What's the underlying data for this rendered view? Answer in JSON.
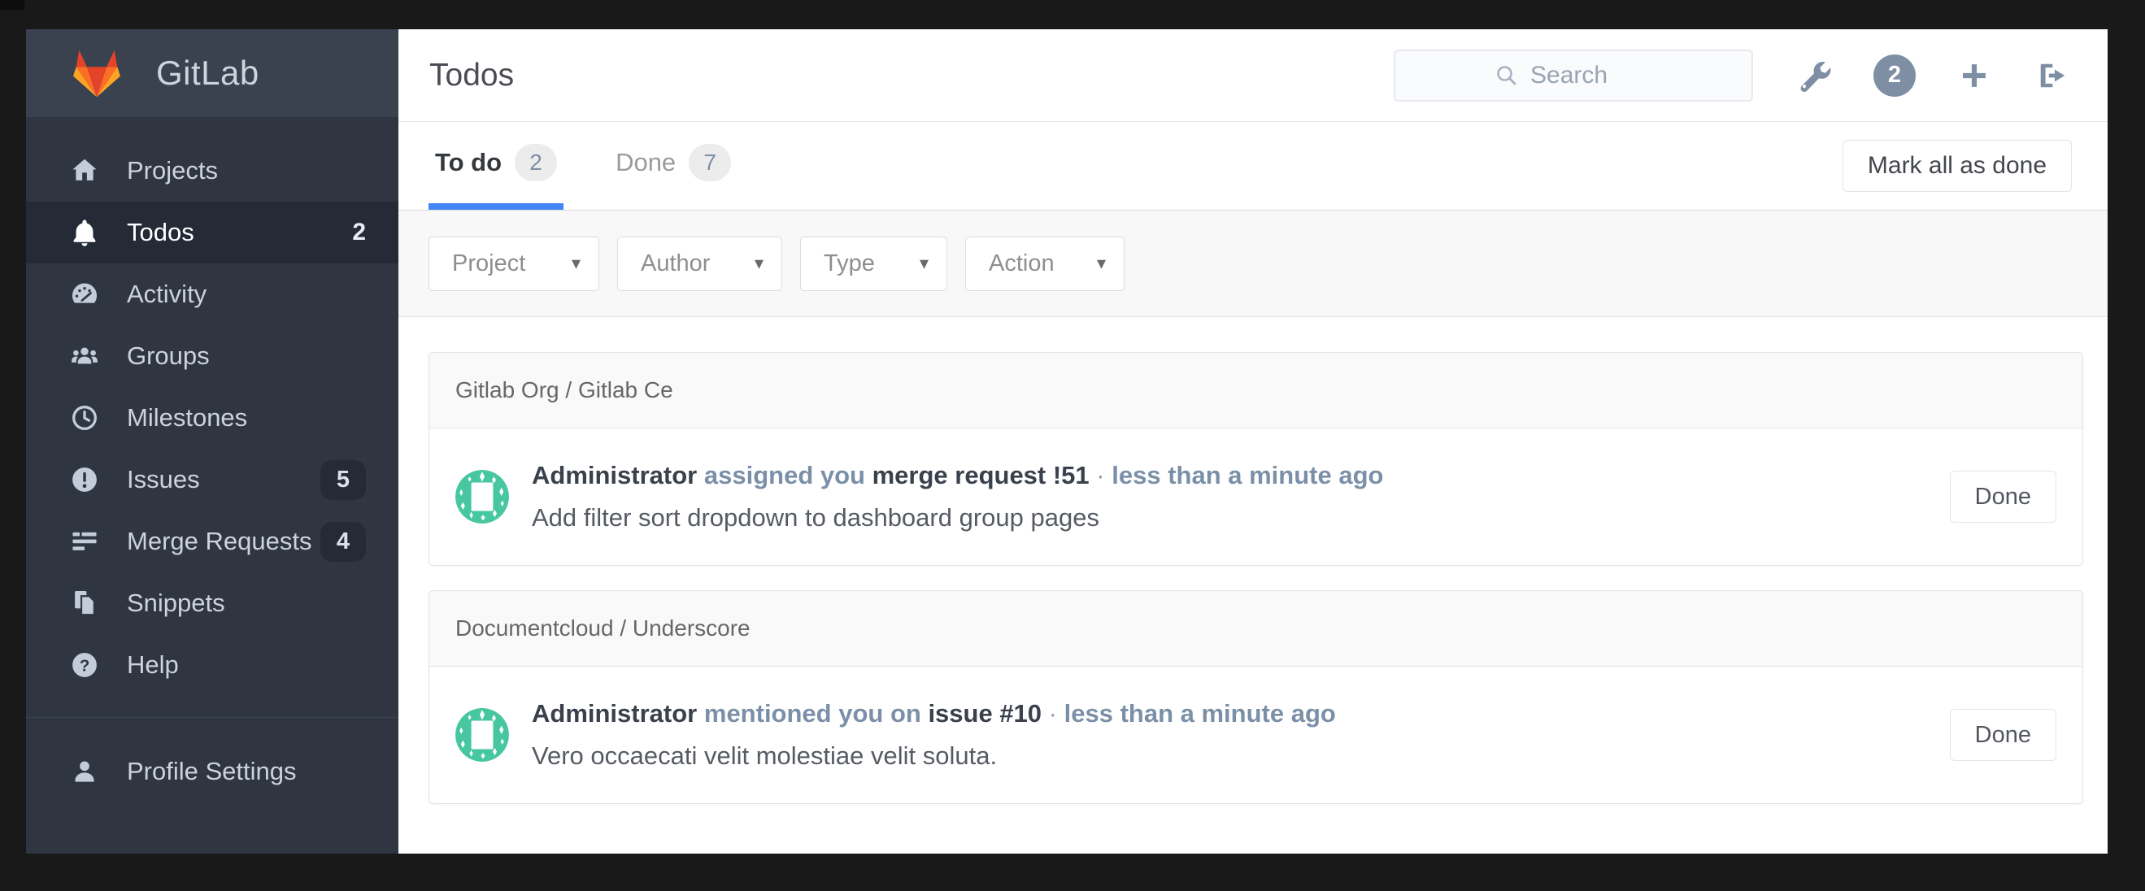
{
  "sidebar": {
    "logo": "GitLab",
    "items": [
      {
        "label": "Projects",
        "icon": "home-icon",
        "badge": ""
      },
      {
        "label": "Todos",
        "icon": "bell-icon",
        "badge": "2"
      },
      {
        "label": "Activity",
        "icon": "dashboard-icon",
        "badge": ""
      },
      {
        "label": "Groups",
        "icon": "groups-icon",
        "badge": ""
      },
      {
        "label": "Milestones",
        "icon": "clock-icon",
        "badge": ""
      },
      {
        "label": "Issues",
        "icon": "issue-icon",
        "badge": "5"
      },
      {
        "label": "Merge Requests",
        "icon": "merge-requests-icon",
        "badge": "4"
      },
      {
        "label": "Snippets",
        "icon": "snippet-icon",
        "badge": ""
      },
      {
        "label": "Help",
        "icon": "help-icon",
        "badge": ""
      }
    ],
    "footer_items": [
      {
        "label": "Profile Settings",
        "icon": "user-icon"
      }
    ]
  },
  "header": {
    "title": "Todos",
    "search_placeholder": "Search",
    "todos_count": "2"
  },
  "tabs": {
    "todo_label": "To do",
    "todo_count": "2",
    "done_label": "Done",
    "done_count": "7"
  },
  "toolbar": {
    "mark_all_label": "Mark all as done"
  },
  "filters": {
    "project": "Project",
    "author": "Author",
    "type": "Type",
    "action": "Action"
  },
  "groups": [
    {
      "project": "Gitlab Org / Gitlab Ce",
      "todo": {
        "author": "Administrator",
        "action": "assigned you",
        "target": "merge request !51",
        "dot": "·",
        "time": "less than a minute ago",
        "body": "Add filter sort dropdown to dashboard group pages",
        "done_label": "Done"
      }
    },
    {
      "project": "Documentcloud / Underscore",
      "todo": {
        "author": "Administrator",
        "action": "mentioned you on",
        "target": "issue #10",
        "dot": "·",
        "time": "less than a minute ago",
        "body": "Vero occaecati velit molestiae velit soluta.",
        "done_label": "Done"
      }
    }
  ],
  "colors": {
    "accent_blue": "#4285f4",
    "link_blue_gray": "#7b90a8",
    "avatar_green": "#46c7a0",
    "sidebar_bg": "#2f3642",
    "header_icon_gray": "#7e8fa4"
  }
}
